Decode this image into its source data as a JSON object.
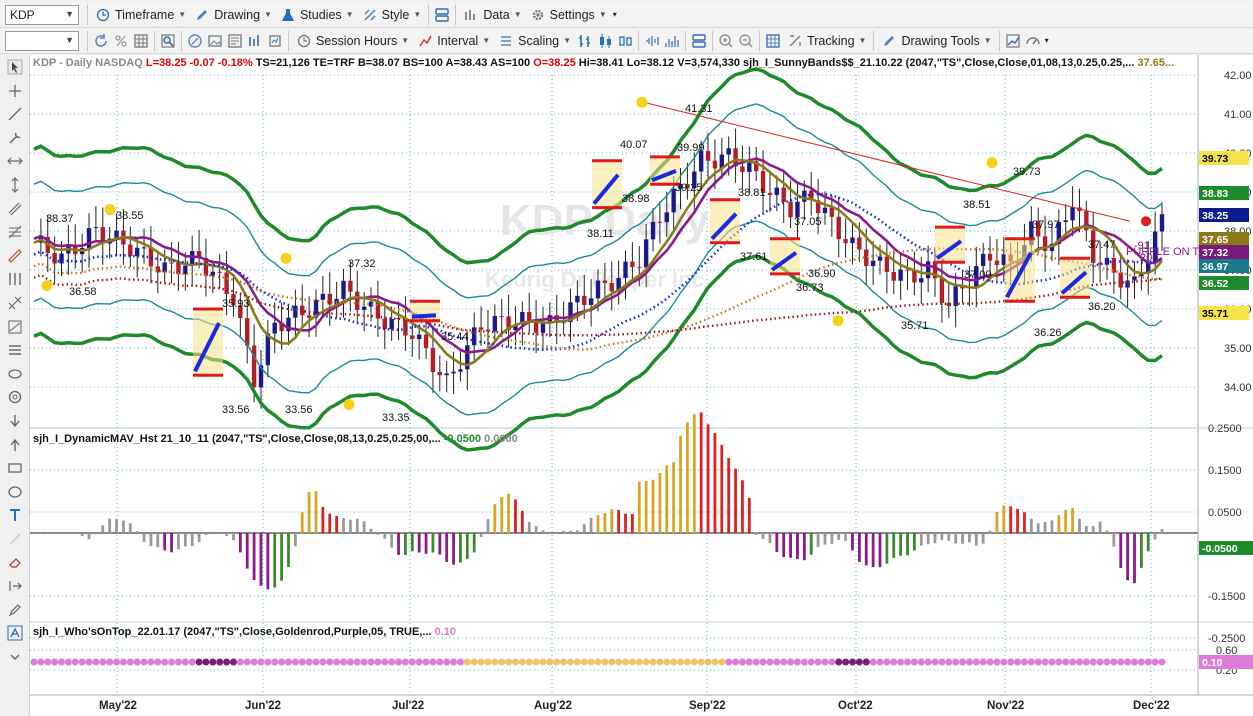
{
  "toolbar1": {
    "symbol": "KDP",
    "timeframe": "Timeframe",
    "drawing": "Drawing",
    "studies": "Studies",
    "style": "Style",
    "data": "Data",
    "settings": "Settings"
  },
  "toolbar2": {
    "interval_value": "",
    "session_hours": "Session Hours",
    "interval": "Interval",
    "scaling": "Scaling",
    "tracking": "Tracking",
    "drawing_tools": "Drawing Tools"
  },
  "price_header": {
    "symbol": "KDP - Daily",
    "exchange": "NASDAQ",
    "last": "L=38.25",
    "change": "-0.07",
    "change_pct": "-0.18%",
    "ts": "TS=21,126",
    "te": "TE=TRF",
    "bid": "B=38.07",
    "bs": "BS=100",
    "ask": "A=38.43",
    "as": "AS=100",
    "open": "O=38.25",
    "high": "Hi=38.41",
    "low": "Lo=38.12",
    "volume": "V=3,574,330",
    "study": "sjh_I_SunnyBands$$_21.10.22 (2047,\"TS\",Close,Close,01,08,13,0.25,0.25,...",
    "study_value": "37.65..."
  },
  "price_axis": [
    "42.00",
    "41.00",
    "40.00",
    "39.00",
    "38.00",
    "37.00",
    "36.00",
    "35.00",
    "34.00"
  ],
  "price_tags": [
    {
      "label": "39.73",
      "color": "#f5e34a",
      "text": "#000"
    },
    {
      "label": "38.83",
      "color": "#1f8a2a",
      "text": "#fff"
    },
    {
      "label": "38.25",
      "color": "#0b1a8c",
      "text": "#fff"
    },
    {
      "label": "37.65",
      "color": "#8b7a1a",
      "text": "#fff"
    },
    {
      "label": "37.32",
      "color": "#7a1a7a",
      "text": "#fff"
    },
    {
      "label": "36.97",
      "color": "#1a7a8a",
      "text": "#fff"
    },
    {
      "label": "36.52",
      "color": "#1f8a2a",
      "text": "#fff"
    },
    {
      "label": "35.71",
      "color": "#f5e34a",
      "text": "#000"
    }
  ],
  "price_annotations": [
    "38.37",
    "38.55",
    "36.58",
    "35.93",
    "37.32",
    "33.56",
    "33.56",
    "33.35",
    "35.44",
    "40.07",
    "41.31",
    "39.99",
    "39.25",
    "38.98",
    "38.11",
    "38.81",
    "37.61",
    "37.05",
    "36.73",
    "36.90",
    "35.71",
    "38.51",
    "37.00",
    "39.73",
    "37.97",
    "36.26",
    "37.47",
    "36.20",
    "PURPLE ON T",
    "200",
    "-91"
  ],
  "watermark": "Keurig Dr Pepper Inc",
  "watermark_sym": "KDP Daily",
  "osc1": {
    "title": "sjh_I_DynamicMAV_Hst 21_10_11 (2047,\"TS\",Close,Close,08,13,0.25,0.25,00,...",
    "v1": "-0.0500",
    "v2": "0.0000",
    "axis": [
      "0.2500",
      "0.1500",
      "0.0500",
      "-0.1500",
      "-0.2500"
    ],
    "tag": "-0.0500"
  },
  "osc2": {
    "title": "sjh_I_Who'sOnTop_22.01.17 (2047,\"TS\",Close,Goldenrod,Purple,05, TRUE,...",
    "v1": "0.10",
    "axis": [
      "0.60",
      "0.20"
    ],
    "tag": "0.10"
  },
  "x_axis": [
    "May'22",
    "Jun'22",
    "Jul'22",
    "Aug'22",
    "Sep'22",
    "Oct'22",
    "Nov'22",
    "Dec'22"
  ]
}
